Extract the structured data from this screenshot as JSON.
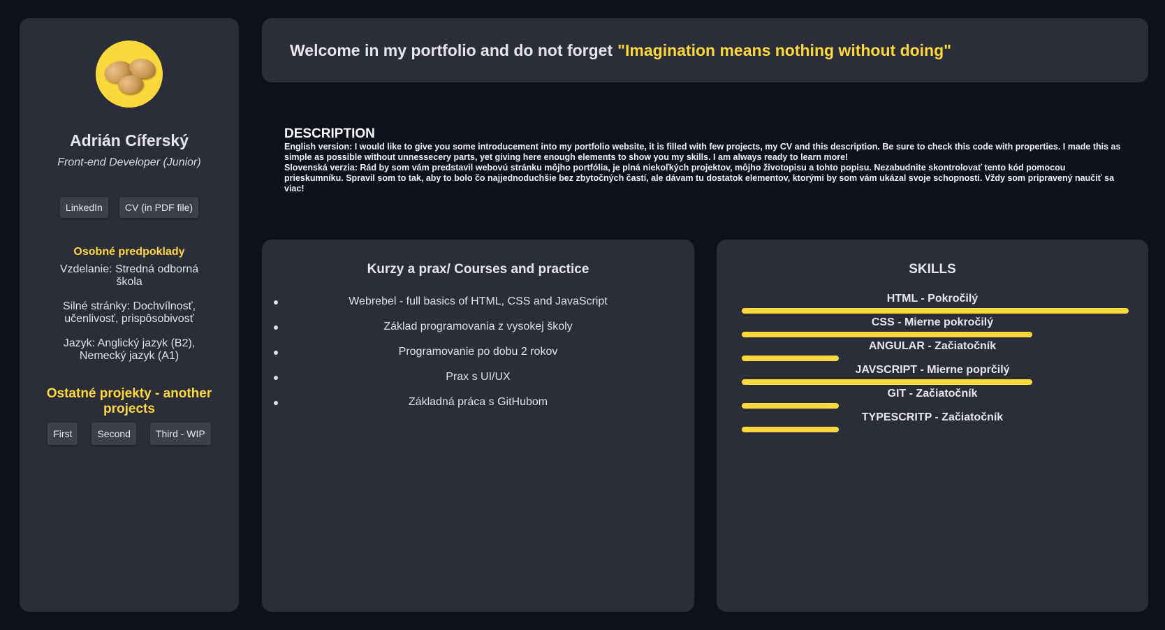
{
  "sidebar": {
    "name": "Adrián Cíferský",
    "role": "Front-end Developer (Junior)",
    "links": [
      "LinkedIn",
      "CV (in PDF file)"
    ],
    "personal_heading": "Osobné predpoklady",
    "personal": [
      "Vzdelanie: Stredná odborná škola",
      "Silné stránky: Dochvílnosť, učenlivosť, prispôsobivosť",
      "Jazyk: Anglický jazyk (B2), Nemecký jazyk (A1)"
    ],
    "projects_heading": "Ostatné projekty - another projects",
    "projects": [
      "First",
      "Second",
      "Third - WIP"
    ]
  },
  "welcome": {
    "text": "Welcome in my portfolio and do not forget",
    "quote": "\"Imagination means nothing without doing\""
  },
  "description": {
    "title": "DESCRIPTION",
    "english": "English version: I would like to give you some introducement into my portfolio website, it is filled with few projects, my CV and this description. Be sure to check this code with properties. I made this as simple as possible without unnessecery parts, yet giving here enough elements to show you my skills. I am always ready to learn more!",
    "slovak": "Slovenská verzia: Rád by som vám predstavil webovú stránku môjho portfólia, je plná niekoľkých projektov, môjho životopisu a tohto popisu. Nezabudnite skontrolovať tento kód pomocou prieskumníku. Spravil som to tak, aby to bolo čo najjednoduchšie bez zbytočných častí, ale dávam tu dostatok elementov, ktorými by som vám ukázal svoje schopnosti. Vždy som pripravený naučiť sa viac!"
  },
  "courses": {
    "title": "Kurzy a prax/ Courses and practice",
    "items": [
      "Webrebel - full basics of HTML, CSS and JavaScript",
      "Základ programovania z vysokej školy",
      "Programovanie po dobu 2 rokov",
      "Prax s UI/UX",
      "Základná práca s GitHubom"
    ]
  },
  "skills": {
    "title": "SKILLS",
    "items": [
      {
        "label": "HTML - Pokročilý",
        "level": 100
      },
      {
        "label": "CSS - Mierne pokročilý",
        "level": 75
      },
      {
        "label": "ANGULAR - Začiatočník",
        "level": 25
      },
      {
        "label": "JAVSCRIPT - Mierne poprčilý",
        "level": 75
      },
      {
        "label": "GIT - Začiatočník",
        "level": 25
      },
      {
        "label": "TYPESCRITP - Začiatočník",
        "level": 25
      }
    ]
  },
  "colors": {
    "accent": "#fbd93c",
    "card": "#2b2d38",
    "background": "#0f121c"
  }
}
